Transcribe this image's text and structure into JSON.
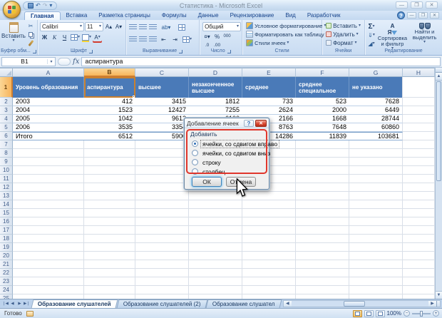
{
  "window": {
    "title": "Статистика - Microsoft Excel"
  },
  "ribbon": {
    "tabs": [
      {
        "label": "Главная",
        "active": true
      },
      {
        "label": "Вставка"
      },
      {
        "label": "Разметка страницы"
      },
      {
        "label": "Формулы"
      },
      {
        "label": "Данные"
      },
      {
        "label": "Рецензирование"
      },
      {
        "label": "Вид"
      },
      {
        "label": "Разработчик"
      }
    ],
    "clipboard": {
      "label": "Буфер обм...",
      "paste": "Вставить"
    },
    "font": {
      "label": "Шрифт",
      "name": "Calibri",
      "size": "11",
      "bold": "Ж",
      "italic": "К",
      "underline": "Ч"
    },
    "alignment": {
      "label": "Выравнивание"
    },
    "number": {
      "label": "Число",
      "format": "Общий",
      "percent": "%",
      "thousands": "000",
      "dec_inc": ".0",
      "dec_dec": ".00"
    },
    "styles": {
      "label": "Стили",
      "conditional": "Условное форматирование",
      "format_table": "Форматировать как таблицу",
      "cell_styles": "Стили ячеек"
    },
    "cells": {
      "label": "Ячейки",
      "insert": "Вставить",
      "delete": "Удалить",
      "format": "Формат"
    },
    "editing": {
      "label": "Редактирование",
      "sigma": "Σ",
      "sort": "Сортировка и фильтр",
      "find": "Найти и выделить"
    }
  },
  "formula_bar": {
    "name_box": "B1",
    "value": "аспирантура"
  },
  "grid": {
    "columns": [
      "A",
      "B",
      "C",
      "D",
      "E",
      "F",
      "G",
      "H"
    ],
    "selected_cell": "B1",
    "selected_column": "B",
    "selected_row": 1,
    "row_count": 25,
    "table": {
      "headers": [
        "Уровень образования",
        "аспирантура",
        "высшее",
        "незаконченное высшее",
        "среднее",
        "среднее специальное",
        "не указано"
      ],
      "rows": [
        [
          "2003",
          "412",
          "3415",
          "1812",
          "733",
          "523",
          "7628"
        ],
        [
          "2004",
          "1523",
          "12427",
          "7255",
          "2624",
          "2000",
          "6449"
        ],
        [
          "2005",
          "1042",
          "9612",
          "6100",
          "2166",
          "1668",
          "28744"
        ],
        [
          "2006",
          "3535",
          "3354",
          "",
          "8763",
          "7648",
          "60860"
        ],
        [
          "Итого",
          "6512",
          "5900",
          "",
          "14286",
          "11839",
          "103681"
        ]
      ]
    }
  },
  "dialog": {
    "title": "Добавление ячеек",
    "group_label": "Добавить",
    "options": [
      {
        "label": "ячейки, со сдвигом вправо",
        "selected": true
      },
      {
        "label": "ячейки, со сдвигом вниз",
        "selected": false
      },
      {
        "label": "строку",
        "selected": false
      },
      {
        "label": "столбец",
        "selected": false
      }
    ],
    "ok": "ОК",
    "cancel": "Отмена"
  },
  "sheet_tabs": [
    {
      "label": "Образование слушателей",
      "active": true
    },
    {
      "label": "Образование слушателей (2)",
      "active": false
    },
    {
      "label": "Образование слушател",
      "active": false
    }
  ],
  "status_bar": {
    "ready": "Готово",
    "zoom": "100%"
  }
}
